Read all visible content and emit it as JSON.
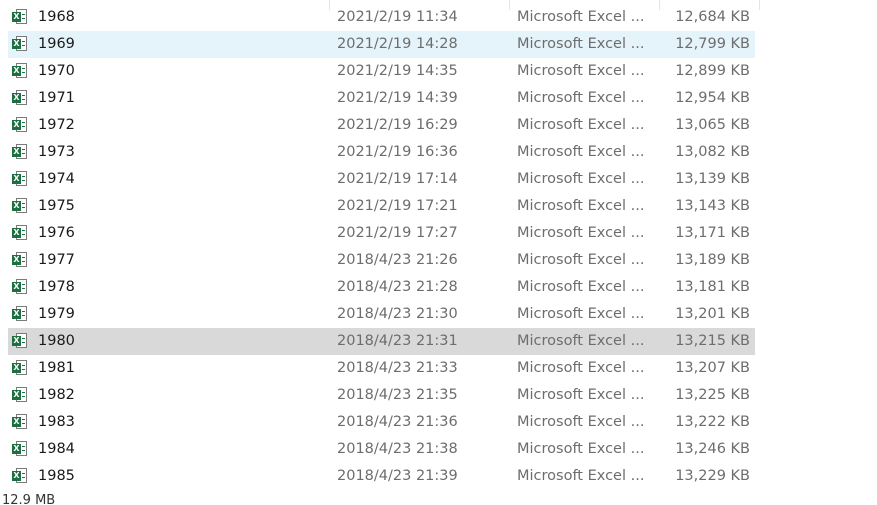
{
  "file_list": {
    "icon": "excel-file-icon",
    "badge_letter": "X",
    "hover_index": 1,
    "selected_index": 12,
    "rows": [
      {
        "name": "1968",
        "date": "2021/2/19 11:34",
        "type": "Microsoft Excel ...",
        "size": "12,684 KB"
      },
      {
        "name": "1969",
        "date": "2021/2/19 14:28",
        "type": "Microsoft Excel ...",
        "size": "12,799 KB"
      },
      {
        "name": "1970",
        "date": "2021/2/19 14:35",
        "type": "Microsoft Excel ...",
        "size": "12,899 KB"
      },
      {
        "name": "1971",
        "date": "2021/2/19 14:39",
        "type": "Microsoft Excel ...",
        "size": "12,954 KB"
      },
      {
        "name": "1972",
        "date": "2021/2/19 16:29",
        "type": "Microsoft Excel ...",
        "size": "13,065 KB"
      },
      {
        "name": "1973",
        "date": "2021/2/19 16:36",
        "type": "Microsoft Excel ...",
        "size": "13,082 KB"
      },
      {
        "name": "1974",
        "date": "2021/2/19 17:14",
        "type": "Microsoft Excel ...",
        "size": "13,139 KB"
      },
      {
        "name": "1975",
        "date": "2021/2/19 17:21",
        "type": "Microsoft Excel ...",
        "size": "13,143 KB"
      },
      {
        "name": "1976",
        "date": "2021/2/19 17:27",
        "type": "Microsoft Excel ...",
        "size": "13,171 KB"
      },
      {
        "name": "1977",
        "date": "2018/4/23 21:26",
        "type": "Microsoft Excel ...",
        "size": "13,189 KB"
      },
      {
        "name": "1978",
        "date": "2018/4/23 21:28",
        "type": "Microsoft Excel ...",
        "size": "13,181 KB"
      },
      {
        "name": "1979",
        "date": "2018/4/23 21:30",
        "type": "Microsoft Excel ...",
        "size": "13,201 KB"
      },
      {
        "name": "1980",
        "date": "2018/4/23 21:31",
        "type": "Microsoft Excel ...",
        "size": "13,215 KB"
      },
      {
        "name": "1981",
        "date": "2018/4/23 21:33",
        "type": "Microsoft Excel ...",
        "size": "13,207 KB"
      },
      {
        "name": "1982",
        "date": "2018/4/23 21:35",
        "type": "Microsoft Excel ...",
        "size": "13,225 KB"
      },
      {
        "name": "1983",
        "date": "2018/4/23 21:36",
        "type": "Microsoft Excel ...",
        "size": "13,222 KB"
      },
      {
        "name": "1984",
        "date": "2018/4/23 21:38",
        "type": "Microsoft Excel ...",
        "size": "13,246 KB"
      },
      {
        "name": "1985",
        "date": "2018/4/23 21:39",
        "type": "Microsoft Excel ...",
        "size": "13,229 KB"
      }
    ]
  },
  "status_bar": {
    "selection_size": "12.9 MB"
  },
  "colors": {
    "hover_row": "#e5f3fb",
    "selected_row": "#d9d9d9",
    "excel_green": "#1d6f42"
  }
}
